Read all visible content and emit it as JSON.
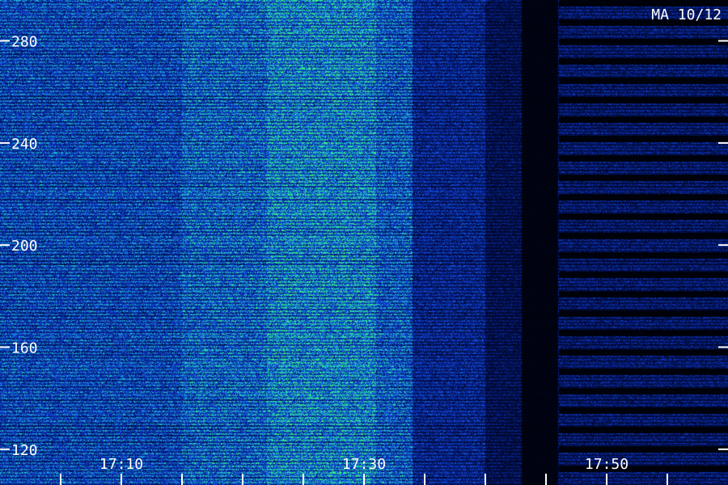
{
  "chart_data": {
    "type": "heatmap",
    "corner_label": "MA 10/12",
    "y_axis": {
      "ticks": [
        120,
        160,
        200,
        240,
        280
      ],
      "range": [
        106,
        296
      ]
    },
    "x_axis": {
      "tick_labels": [
        {
          "label": "17:10",
          "minute": 10
        },
        {
          "label": "17:30",
          "minute": 30
        },
        {
          "label": "17:50",
          "minute": 50
        }
      ],
      "minor_tick_step_minutes": 5,
      "range_minutes": [
        0,
        60
      ]
    },
    "intensity_regions": [
      {
        "from_minute": 0,
        "to_minute": 15,
        "level": 0.55
      },
      {
        "from_minute": 15,
        "to_minute": 22,
        "level": 0.62
      },
      {
        "from_minute": 22,
        "to_minute": 31,
        "level": 0.7
      },
      {
        "from_minute": 31,
        "to_minute": 34,
        "level": 0.6
      },
      {
        "from_minute": 34,
        "to_minute": 40,
        "level": 0.42
      },
      {
        "from_minute": 40,
        "to_minute": 43,
        "level": 0.3
      },
      {
        "from_minute": 43,
        "to_minute": 46,
        "level": 0.08
      },
      {
        "from_minute": 46,
        "to_minute": 60,
        "level": 0.35
      }
    ],
    "colors": {
      "background": "#000000",
      "low": "#000a3c",
      "mid": "#1040e0",
      "high": "#20d0c0",
      "peak": "#40ff60",
      "text": "#ffffff"
    }
  }
}
